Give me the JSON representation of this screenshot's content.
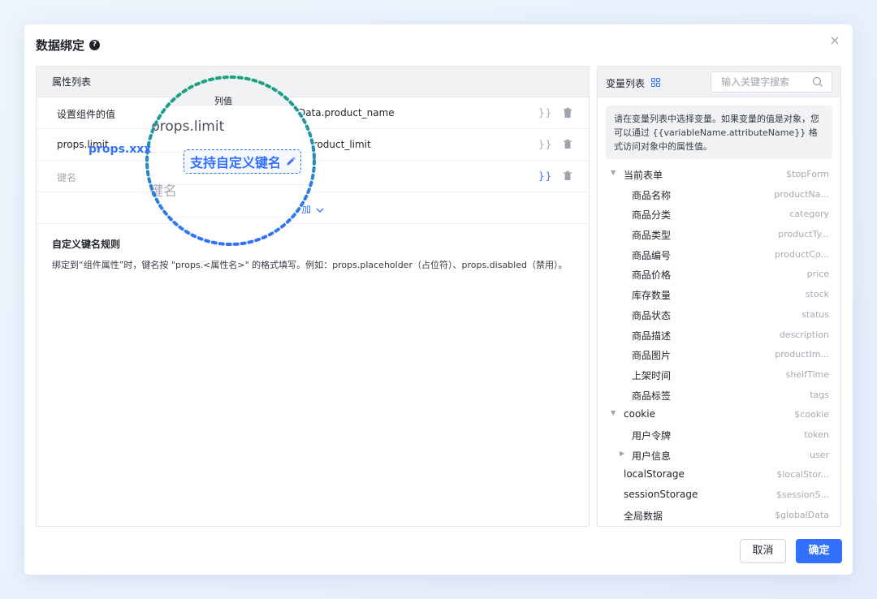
{
  "dialog": {
    "title": "数据绑定",
    "help_icon": "question-circle-icon",
    "close_icon": "×"
  },
  "left_panel": {
    "header": {
      "col1": "属性列表"
    },
    "rows": [
      {
        "name": "设置组件的值",
        "value": "Data.product_name",
        "brace": "}}"
      },
      {
        "name": "props.limit",
        "value": "a.product_limit",
        "brace": "}}"
      },
      {
        "name": "键名",
        "value": "",
        "brace": "}}"
      }
    ],
    "add_label": "加",
    "rules_title": "自定义键名规则",
    "rules_desc": "绑定到“组件属性”时，键名按 \"props.<属性名>\" 的格式填写。例如：props.placeholder（占位符）、props.disabled（禁用）。"
  },
  "magnifier": {
    "header_text": "列值",
    "big_text": "props.limit",
    "placeholder": "键名",
    "props_text": "props.xxx",
    "chip_label": "支持自定义键名"
  },
  "right_panel": {
    "title": "变量列表",
    "search_placeholder": "输入关键字搜索",
    "hint": "请在变量列表中选择变量。如果变量的值是对象，您可以通过 {{variableName.attributeName}} 格式访问对象中的属性值。",
    "tree": [
      {
        "label": "当前表单",
        "key": "$topForm",
        "level": 0,
        "caret": "down"
      },
      {
        "label": "商品名称",
        "key": "productNa...",
        "level": 1,
        "caret": ""
      },
      {
        "label": "商品分类",
        "key": "category",
        "level": 1,
        "caret": ""
      },
      {
        "label": "商品类型",
        "key": "productTy...",
        "level": 1,
        "caret": ""
      },
      {
        "label": "商品编号",
        "key": "productCo...",
        "level": 1,
        "caret": ""
      },
      {
        "label": "商品价格",
        "key": "price",
        "level": 1,
        "caret": ""
      },
      {
        "label": "库存数量",
        "key": "stock",
        "level": 1,
        "caret": ""
      },
      {
        "label": "商品状态",
        "key": "status",
        "level": 1,
        "caret": ""
      },
      {
        "label": "商品描述",
        "key": "description",
        "level": 1,
        "caret": ""
      },
      {
        "label": "商品图片",
        "key": "productIm...",
        "level": 1,
        "caret": ""
      },
      {
        "label": "上架时间",
        "key": "shelfTime",
        "level": 1,
        "caret": ""
      },
      {
        "label": "商品标签",
        "key": "tags",
        "level": 1,
        "caret": ""
      },
      {
        "label": "cookie",
        "key": "$cookie",
        "level": 0,
        "caret": "down"
      },
      {
        "label": "用户令牌",
        "key": "token",
        "level": 1,
        "caret": ""
      },
      {
        "label": "用户信息",
        "key": "user",
        "level": 1,
        "caret": "right"
      },
      {
        "label": "localStorage",
        "key": "$localStor...",
        "level": 0,
        "caret": ""
      },
      {
        "label": "sessionStorage",
        "key": "$sessionS...",
        "level": 0,
        "caret": ""
      },
      {
        "label": "全局数据",
        "key": "$globalData",
        "level": 0,
        "caret": ""
      }
    ]
  },
  "footer": {
    "cancel": "取消",
    "ok": "确定"
  },
  "colors": {
    "accent": "#3370ff",
    "ring_green": "#1aa37a",
    "ring_blue": "#3370ff"
  }
}
